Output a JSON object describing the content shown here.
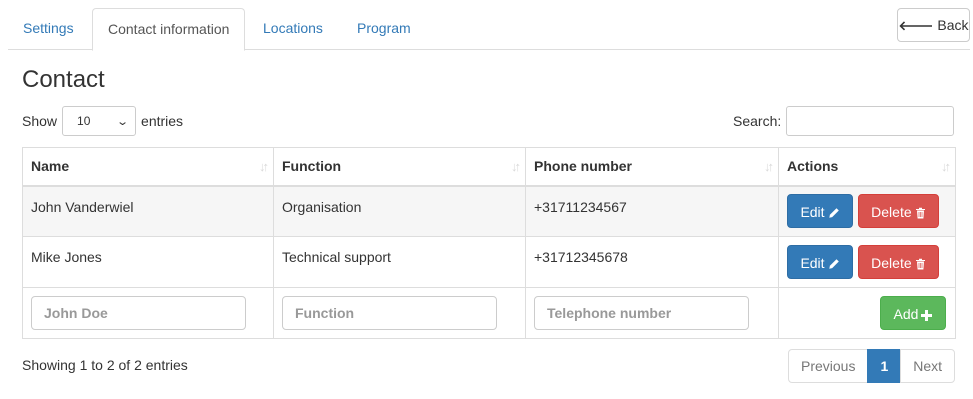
{
  "tabs": [
    {
      "label": "Settings",
      "active": false
    },
    {
      "label": "Contact information",
      "active": true
    },
    {
      "label": "Locations",
      "active": false
    },
    {
      "label": "Program",
      "active": false
    }
  ],
  "back_label": "Back",
  "title": "Contact",
  "length": {
    "show_label": "Show",
    "value": "10",
    "entries_label": "entries"
  },
  "search": {
    "label": "Search:",
    "value": ""
  },
  "columns": [
    "Name",
    "Function",
    "Phone number",
    "Actions"
  ],
  "rows": [
    {
      "name": "John Vanderwiel",
      "function": "Organisation",
      "phone": "+31711234567"
    },
    {
      "name": "Mike Jones",
      "function": "Technical support",
      "phone": "+31712345678"
    }
  ],
  "actions": {
    "edit": "Edit",
    "delete": "Delete",
    "add": "Add"
  },
  "new_row": {
    "name_placeholder": "John Doe",
    "function_placeholder": "Function",
    "phone_placeholder": "Telephone number"
  },
  "info": "Showing 1 to 2 of 2 entries",
  "pagination": {
    "previous": "Previous",
    "current": "1",
    "next": "Next"
  },
  "colors": {
    "primary": "#337ab7",
    "danger": "#d9534f",
    "success": "#5cb85c"
  }
}
